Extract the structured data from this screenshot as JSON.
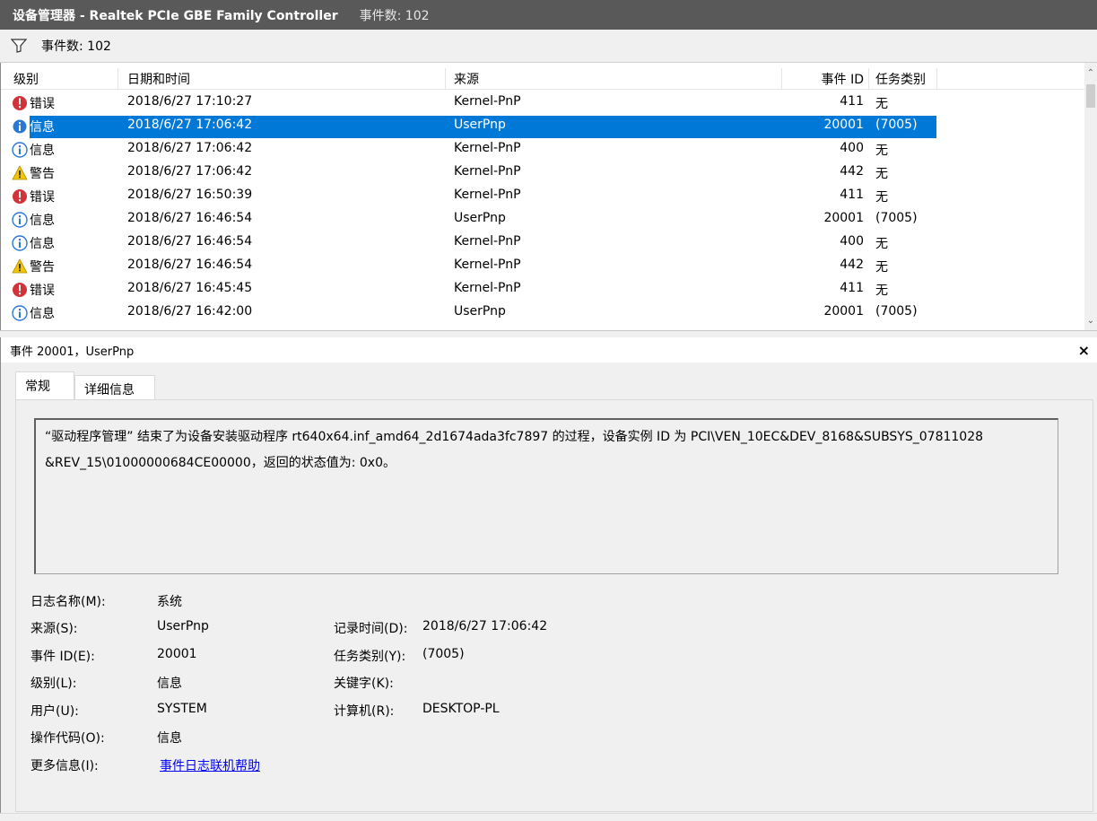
{
  "window": {
    "title": "设备管理器 - Realtek PCIe GBE Family Controller",
    "event_count_label": "事件数: 102"
  },
  "filter": {
    "count_label": "事件数: 102",
    "icon": "filter-icon"
  },
  "list": {
    "columns": [
      "级别",
      "日期和时间",
      "来源",
      "事件 ID",
      "任务类别"
    ],
    "rows": [
      {
        "level": "错误",
        "level_icon": "error-icon",
        "datetime": "2018/6/27 17:10:27",
        "source": "Kernel-PnP",
        "event_id": "411",
        "task": "无"
      },
      {
        "level": "信息",
        "level_icon": "info-icon",
        "datetime": "2018/6/27 17:06:42",
        "source": "UserPnp",
        "event_id": "20001",
        "task": "(7005)",
        "selected": true
      },
      {
        "level": "信息",
        "level_icon": "info-icon",
        "datetime": "2018/6/27 17:06:42",
        "source": "Kernel-PnP",
        "event_id": "400",
        "task": "无"
      },
      {
        "level": "警告",
        "level_icon": "warning-icon",
        "datetime": "2018/6/27 17:06:42",
        "source": "Kernel-PnP",
        "event_id": "442",
        "task": "无"
      },
      {
        "level": "错误",
        "level_icon": "error-icon",
        "datetime": "2018/6/27 16:50:39",
        "source": "Kernel-PnP",
        "event_id": "411",
        "task": "无"
      },
      {
        "level": "信息",
        "level_icon": "info-icon",
        "datetime": "2018/6/27 16:46:54",
        "source": "UserPnp",
        "event_id": "20001",
        "task": "(7005)"
      },
      {
        "level": "信息",
        "level_icon": "info-icon",
        "datetime": "2018/6/27 16:46:54",
        "source": "Kernel-PnP",
        "event_id": "400",
        "task": "无"
      },
      {
        "level": "警告",
        "level_icon": "warning-icon",
        "datetime": "2018/6/27 16:46:54",
        "source": "Kernel-PnP",
        "event_id": "442",
        "task": "无"
      },
      {
        "level": "错误",
        "level_icon": "error-icon",
        "datetime": "2018/6/27 16:45:45",
        "source": "Kernel-PnP",
        "event_id": "411",
        "task": "无"
      },
      {
        "level": "信息",
        "level_icon": "info-icon",
        "datetime": "2018/6/27 16:42:00",
        "source": "UserPnp",
        "event_id": "20001",
        "task": "(7005)"
      }
    ]
  },
  "detail": {
    "header_title": "事件 20001，UserPnp",
    "close_label": "×",
    "tabs": [
      "常规",
      "详细信息"
    ],
    "description_line1": "“驱动程序管理” 结束了为设备安装驱动程序 rt640x64.inf_amd64_2d1674ada3fc7897 的过程，设备实例 ID 为 PCI\\VEN_10EC&DEV_8168&SUBSYS_07811028",
    "description_line2": "&REV_15\\01000000684CE00000，返回的状态值为: 0x0。",
    "props": {
      "log_name_label": "日志名称(M):",
      "log_name": "系统",
      "source_label": "来源(S):",
      "source": "UserPnp",
      "logged_label": "记录时间(D):",
      "logged": "2018/6/27 17:06:42",
      "event_id_label": "事件 ID(E):",
      "event_id": "20001",
      "task_label": "任务类别(Y):",
      "task": "(7005)",
      "level_label": "级别(L):",
      "level": "信息",
      "keywords_label": "关键字(K):",
      "keywords": "",
      "user_label": "用户(U):",
      "user": "SYSTEM",
      "computer_label": "计算机(R):",
      "computer": "DESKTOP-PL",
      "opcode_label": "操作代码(O):",
      "opcode": "信息",
      "more_info_label": "更多信息(I):",
      "more_info_link": "事件日志联机帮助"
    }
  },
  "colors": {
    "selection": "#0078d7",
    "titlebar": "#595959",
    "error": "#d13438",
    "info": "#2b78d4",
    "warning": "#f2c500"
  }
}
